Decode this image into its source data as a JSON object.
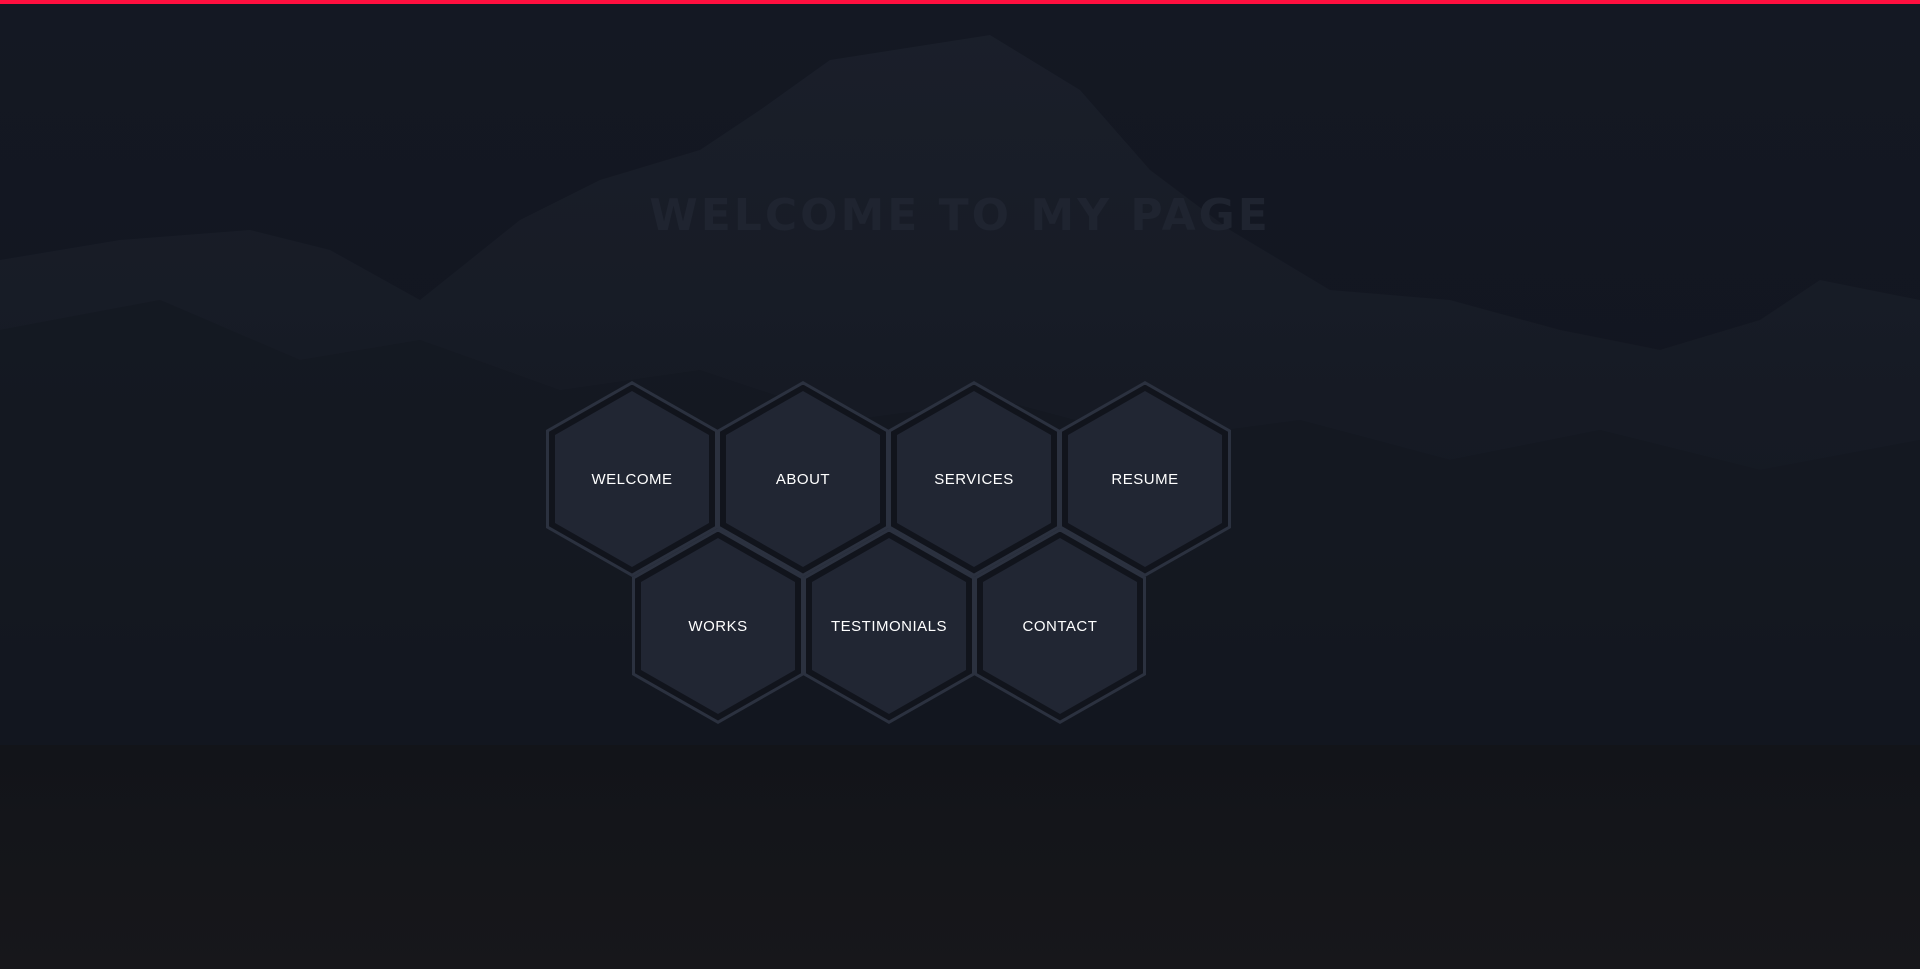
{
  "colors": {
    "accent_bar": "#ff0f3f",
    "background": "#131720",
    "hex_fill": "#212633",
    "hex_border": "#2b313f",
    "label": "#ffffff"
  },
  "hero": {
    "heading": "WELCOME TO MY PAGE"
  },
  "nav": {
    "items": [
      {
        "label": "WELCOME"
      },
      {
        "label": "ABOUT"
      },
      {
        "label": "SERVICES"
      },
      {
        "label": "RESUME"
      },
      {
        "label": "WORKS"
      },
      {
        "label": "TESTIMONIALS"
      },
      {
        "label": "CONTACT"
      }
    ]
  }
}
